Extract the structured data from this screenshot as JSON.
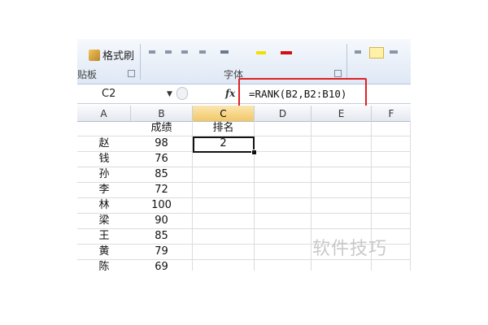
{
  "ribbon": {
    "format_painter_label": "格式刷",
    "clipboard_group_label": "贴板",
    "font_group_label": "字体"
  },
  "formula_bar": {
    "name_box": "C2",
    "fx_label": "fx",
    "formula": "=RANK(B2,B2:B10)"
  },
  "sheet": {
    "columns": [
      "A",
      "B",
      "C",
      "D",
      "E",
      "F"
    ],
    "selected_column": "C",
    "header_row": [
      "",
      "成绩",
      "排名"
    ],
    "rows": [
      {
        "name": "赵",
        "score": "98",
        "rank": "2"
      },
      {
        "name": "钱",
        "score": "76",
        "rank": ""
      },
      {
        "name": "孙",
        "score": "85",
        "rank": ""
      },
      {
        "name": "李",
        "score": "72",
        "rank": ""
      },
      {
        "name": "林",
        "score": "100",
        "rank": ""
      },
      {
        "name": "梁",
        "score": "90",
        "rank": ""
      },
      {
        "name": "王",
        "score": "85",
        "rank": ""
      },
      {
        "name": "黄",
        "score": "79",
        "rank": ""
      },
      {
        "name": "陈",
        "score": "69",
        "rank": ""
      }
    ]
  },
  "watermark": "软件技巧",
  "colors": {
    "highlight_border": "#e02020",
    "selected_header": "#f2c866"
  }
}
